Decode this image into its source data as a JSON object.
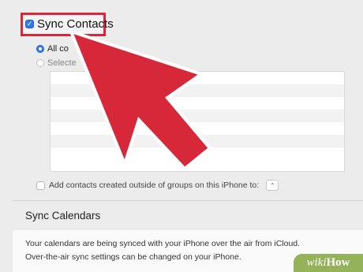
{
  "contacts": {
    "sync_checkbox_mark": "✓",
    "sync_label": "Sync Contacts",
    "option_all": "All co",
    "option_selected": "Selecte",
    "add_contacts_label": "Add contacts created outside of groups on this iPhone to:",
    "stepper_glyph": "⌃"
  },
  "calendars": {
    "title": "Sync Calendars",
    "info_line_1": "Your calendars are being synced with your iPhone over the air from iCloud.",
    "info_line_2": "Over-the-air sync settings can be changed on your iPhone."
  },
  "watermark": {
    "wiki": "wiki",
    "how": "How"
  },
  "colors": {
    "accent": "#2d7bf0",
    "annotation_red": "#d7283a",
    "watermark_green": "#93b25a"
  },
  "icons": [
    "checkbox-icon",
    "radio-icon",
    "stepper-icon",
    "pointer-arrow-icon"
  ]
}
